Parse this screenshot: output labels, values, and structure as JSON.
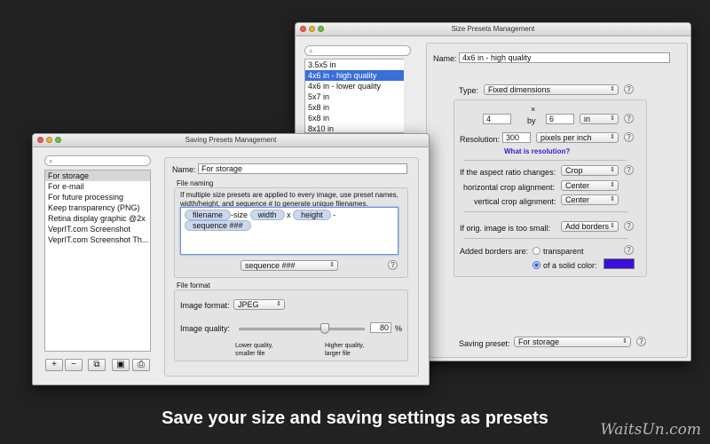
{
  "back_window": {
    "title": "Size Presets Management",
    "presets": [
      "3.5x5 in",
      "4x6 in - high quality",
      "4x6 in - lower quality",
      "5x7 in",
      "5x8 in",
      "6x8 in",
      "8x10 in"
    ],
    "selected_index": 1,
    "name_label": "Name:",
    "name_value": "4x6 in - high quality",
    "type_label": "Type:",
    "type_value": "Fixed dimensions",
    "times_symbol": "×",
    "width_value": "4",
    "by_label": "by",
    "height_value": "6",
    "unit_value": "in",
    "resolution_label": "Resolution:",
    "resolution_value": "300",
    "resolution_unit": "pixels per inch",
    "resolution_link": "What is resolution?",
    "aspect_label": "If the aspect ratio changes:",
    "aspect_value": "Crop",
    "hcrop_label": "horizontal crop alignment:",
    "hcrop_value": "Center",
    "vcrop_label": "vertical crop alignment:",
    "vcrop_value": "Center",
    "small_label": "If orig. image is too small:",
    "small_value": "Add borders",
    "borders_label": "Added borders are:",
    "border_option_transparent": "transparent",
    "border_option_solid": "of a solid color:",
    "border_color": "#3a10d8",
    "saving_preset_label": "Saving preset:",
    "saving_preset_value": "For storage",
    "help_symbol": "?"
  },
  "front_window": {
    "title": "Saving Presets Management",
    "presets": [
      "For storage",
      "For e-mail",
      "For future processing",
      "Keep transparency (PNG)",
      "Retina display graphic @2x",
      "VeprIT.com Screenshot",
      "VeprIT.com Screenshot Th..."
    ],
    "selected_index": 0,
    "name_label": "Name:",
    "name_value": "For storage",
    "file_naming_label": "File naming",
    "file_naming_help": "If multiple size presets are applied to every image, use preset names, width/height, and sequence # to generate unique filenames.",
    "tokens": {
      "filename": "filename",
      "size_text": "-size",
      "width": "width",
      "x_text": "x",
      "height": "height",
      "dash_text": "-",
      "sequence": "sequence ###"
    },
    "insert_popup": "sequence ###",
    "file_format_label": "File format",
    "image_format_label": "Image format:",
    "image_format_value": "JPEG",
    "image_quality_label": "Image quality:",
    "image_quality_value": "80",
    "quality_fraction": 0.8,
    "percent_symbol": "%",
    "lower_quality_label": "Lower quality, smaller file",
    "higher_quality_label": "Higher quality, larger file",
    "buttons": {
      "add": "+",
      "remove": "−"
    },
    "help_symbol": "?"
  },
  "caption": "Save your size and saving settings as presets",
  "watermark": "WaitsUn.com"
}
